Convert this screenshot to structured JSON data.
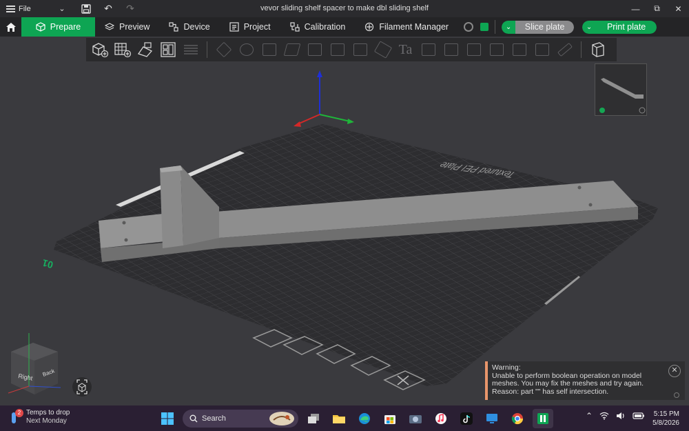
{
  "titlebar": {
    "menu_label": "File",
    "title": "vevor sliding shelf spacer to make dbl sliding shelf",
    "icons": [
      "hamburger-menu-icon",
      "chevron-down-icon",
      "save-icon",
      "undo-icon",
      "redo-icon"
    ],
    "window_controls": [
      "minimize-icon",
      "restore-icon",
      "close-icon"
    ]
  },
  "nav": {
    "tabs": [
      {
        "label": "Prepare",
        "icon": "cube-icon",
        "active": true
      },
      {
        "label": "Preview",
        "icon": "layers-icon",
        "active": false
      },
      {
        "label": "Device",
        "icon": "device-icon",
        "active": false
      },
      {
        "label": "Project",
        "icon": "project-icon",
        "active": false
      },
      {
        "label": "Calibration",
        "icon": "calibration-icon",
        "active": false
      },
      {
        "label": "Filament Manager",
        "icon": "filament-icon",
        "active": false
      }
    ],
    "slice_label": "Slice plate",
    "print_label": "Print plate"
  },
  "viewport": {
    "plate_text": "Textured PEI Plate",
    "plate_number": "01",
    "view_cube_labels": {
      "front": "Right",
      "side": "Back"
    }
  },
  "warning": {
    "title": "Warning:",
    "line1": "Unable to perform boolean operation on model",
    "line2": "meshes. You may fix the meshes and try again.",
    "line3": "Reason: part \"\" has self intersection."
  },
  "taskbar": {
    "weather_badge": "2",
    "weather_title": "Temps to drop",
    "weather_sub": "Next Monday",
    "search_label": "Search",
    "time": "5:15 PM",
    "date": "5/8/2026"
  },
  "colors": {
    "accent": "#0ea553",
    "warning_bar": "#e8956b",
    "toolbar_bg": "#2a2a2c",
    "viewport_bg": "#3a3a3e"
  }
}
